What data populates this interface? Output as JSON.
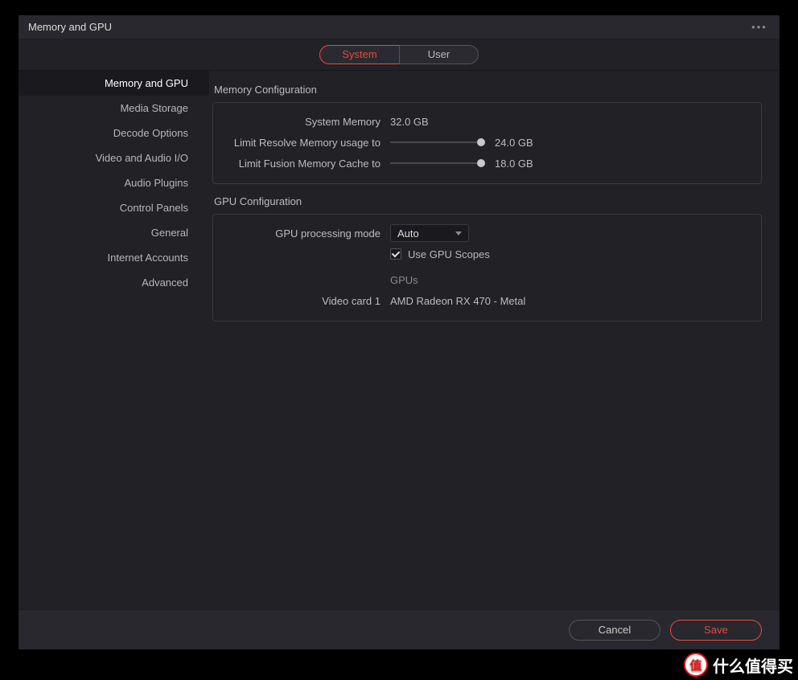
{
  "header": {
    "title": "Memory and GPU"
  },
  "tabs": {
    "system": "System",
    "user": "User"
  },
  "sidebar": {
    "items": [
      "Memory and GPU",
      "Media Storage",
      "Decode Options",
      "Video and Audio I/O",
      "Audio Plugins",
      "Control Panels",
      "General",
      "Internet Accounts",
      "Advanced"
    ],
    "active_index": 0
  },
  "memory": {
    "section_title": "Memory Configuration",
    "system_memory_label": "System Memory",
    "system_memory_value": "32.0 GB",
    "resolve_limit_label": "Limit Resolve Memory usage to",
    "resolve_limit_value": "24.0 GB",
    "fusion_limit_label": "Limit Fusion Memory Cache to",
    "fusion_limit_value": "18.0 GB"
  },
  "gpu": {
    "section_title": "GPU Configuration",
    "mode_label": "GPU processing mode",
    "mode_value": "Auto",
    "use_scopes_label": "Use GPU Scopes",
    "use_scopes_checked": true,
    "gpus_header": "GPUs",
    "card1_label": "Video card 1",
    "card1_value": "AMD Radeon RX 470 - Metal"
  },
  "footer": {
    "cancel": "Cancel",
    "save": "Save"
  },
  "watermark": {
    "badge": "值",
    "text": "什么值得买"
  },
  "colors": {
    "accent": "#e64b3d",
    "panel_border": "#3a3a40",
    "bg": "#212126",
    "header_bg": "#28282e"
  }
}
